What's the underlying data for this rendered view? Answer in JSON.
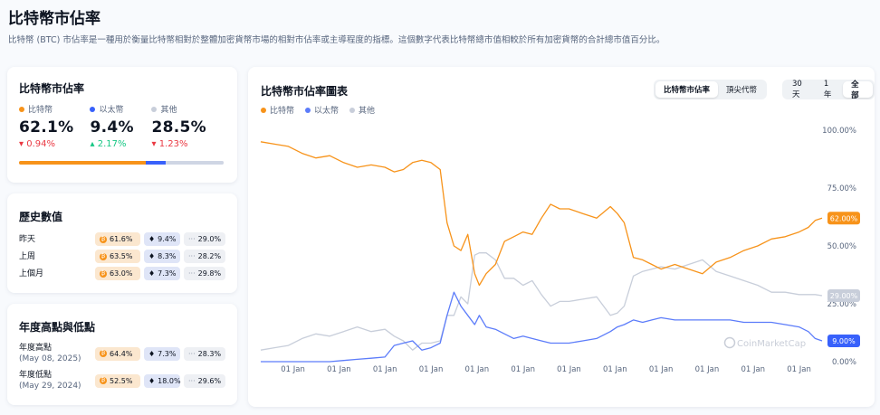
{
  "page": {
    "title": "比特幣市佔率",
    "description": "比特幣 (BTC) 市佔率是一種用於衡量比特幣相對於整體加密貨幣市場的相對市佔率或主導程度的指標。這個數字代表比特幣總市值相較於所有加密貨幣的合計總市值百分比。"
  },
  "colors": {
    "btc": "#f7931a",
    "eth": "#5c7cfa",
    "others": "#c8ceda"
  },
  "dominance": {
    "title": "比特幣市佔率",
    "items": [
      {
        "label": "比特幣",
        "value": "62.1%",
        "change": "0.94%",
        "direction": "down",
        "share": 62.1
      },
      {
        "label": "以太幣",
        "value": "9.4%",
        "change": "2.17%",
        "direction": "up",
        "share": 9.4
      },
      {
        "label": "其他",
        "value": "28.5%",
        "change": "1.23%",
        "direction": "down",
        "share": 28.5
      }
    ]
  },
  "history": {
    "title": "歷史數值",
    "rows": [
      {
        "label": "昨天",
        "btc": "61.6%",
        "eth": "9.4%",
        "others": "29.0%"
      },
      {
        "label": "上周",
        "btc": "63.5%",
        "eth": "8.3%",
        "others": "28.2%"
      },
      {
        "label": "上個月",
        "btc": "63.0%",
        "eth": "7.3%",
        "others": "29.8%"
      }
    ]
  },
  "yearly": {
    "title": "年度高點與低點",
    "rows": [
      {
        "label": "年度高點",
        "date": "(May 08, 2025)",
        "btc": "64.4%",
        "eth": "7.3%",
        "others": "28.3%"
      },
      {
        "label": "年度低點",
        "date": "(May 29, 2024)",
        "btc": "52.5%",
        "eth": "18.0%",
        "others": "29.6%"
      }
    ]
  },
  "chart_card": {
    "title": "比特幣市佔率圖表",
    "tabs": [
      "比特幣市佔率",
      "頂尖代幣"
    ],
    "active_tab": 0,
    "ranges": [
      "30天",
      "1年",
      "全部"
    ],
    "active_range": 2,
    "legend": [
      "比特幣",
      "以太幣",
      "其他"
    ],
    "watermark": "CoinMarketCap"
  },
  "chart_data": {
    "type": "line",
    "x": [
      2013.3,
      2013.6,
      2013.9,
      2014.2,
      2014.5,
      2014.8,
      2015.1,
      2015.4,
      2015.7,
      2016.0,
      2016.2,
      2016.4,
      2016.6,
      2016.8,
      2017.0,
      2017.2,
      2017.35,
      2017.5,
      2017.65,
      2017.8,
      2017.95,
      2018.05,
      2018.2,
      2018.4,
      2018.6,
      2018.8,
      2019.0,
      2019.2,
      2019.4,
      2019.6,
      2019.8,
      2020.0,
      2020.3,
      2020.6,
      2020.9,
      2021.05,
      2021.2,
      2021.4,
      2021.6,
      2021.8,
      2022.0,
      2022.3,
      2022.6,
      2022.9,
      2023.2,
      2023.5,
      2023.8,
      2024.1,
      2024.4,
      2024.7,
      2025.0,
      2025.2,
      2025.35,
      2025.5
    ],
    "series": [
      {
        "name": "比特幣",
        "values": [
          95,
          94,
          93,
          90,
          88,
          89,
          86,
          84,
          85,
          84,
          82,
          83,
          86,
          87,
          86,
          83,
          60,
          50,
          48,
          55,
          38,
          33,
          38,
          42,
          52,
          54,
          56,
          55,
          62,
          68,
          66,
          66,
          64,
          62,
          67,
          64,
          60,
          45,
          44,
          42,
          40,
          42,
          40,
          38,
          43,
          45,
          48,
          50,
          53,
          54,
          56,
          58,
          61,
          62
        ]
      },
      {
        "name": "以太幣",
        "values": [
          0,
          0,
          0,
          0,
          0,
          0,
          0.5,
          1,
          1.5,
          2,
          7,
          8,
          9,
          5,
          6,
          8,
          20,
          30,
          24,
          20,
          16,
          20,
          15,
          14,
          12,
          10,
          11,
          10,
          9,
          8,
          8,
          8,
          9,
          10,
          13,
          15,
          16,
          18,
          17,
          18,
          19,
          18,
          18,
          18,
          18,
          18,
          17,
          17,
          17,
          16,
          15,
          13,
          10,
          9
        ]
      },
      {
        "name": "其他",
        "values": [
          5,
          6,
          7,
          10,
          12,
          11,
          13,
          15,
          13,
          14,
          11,
          9,
          5,
          8,
          8,
          9,
          20,
          20,
          28,
          25,
          46,
          47,
          47,
          44,
          36,
          36,
          33,
          35,
          29,
          24,
          26,
          26,
          27,
          28,
          20,
          21,
          24,
          37,
          39,
          40,
          41,
          40,
          42,
          44,
          39,
          37,
          35,
          33,
          30,
          30,
          29,
          29,
          29,
          28.5
        ]
      }
    ],
    "x_tick_labels": [
      "01 Jan",
      "01 Jan",
      "01 Jan",
      "01 Jan",
      "01 Jan",
      "01 Jan",
      "01 Jan",
      "01 Jan",
      "01 Jan",
      "01 Jan",
      "01 Jan",
      "01 Jan"
    ],
    "x_tick_values": [
      2014,
      2015,
      2016,
      2017,
      2018,
      2019,
      2020,
      2021,
      2022,
      2023,
      2024,
      2025
    ],
    "xlim": [
      2013.3,
      2025.5
    ],
    "y_ticks": [
      0,
      25,
      50,
      75,
      100
    ],
    "y_tick_labels": [
      "0.00%",
      "25.00%",
      "50.00%",
      "75.00%",
      "100.00%"
    ],
    "ylim": [
      0,
      100
    ],
    "end_labels": [
      "62.00%",
      "9.00%",
      "29.00%"
    ],
    "grid": false
  }
}
